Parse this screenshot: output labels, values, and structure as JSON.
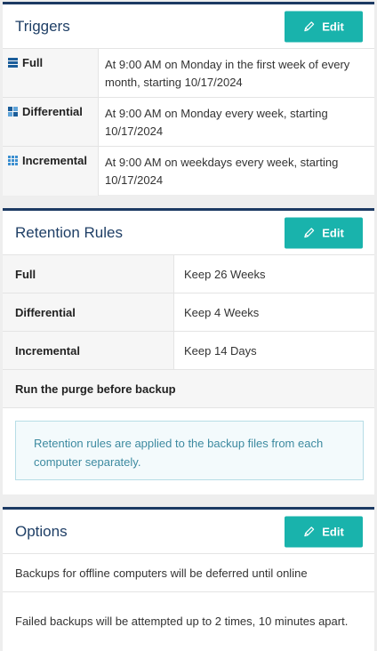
{
  "triggers": {
    "title": "Triggers",
    "edit_label": "Edit",
    "rows": [
      {
        "icon": "full-backup-icon",
        "name": "Full",
        "schedule": "At 9:00 AM on Monday in the first week of every month, starting 10/17/2024"
      },
      {
        "icon": "differential-backup-icon",
        "name": "Differential",
        "schedule": "At 9:00 AM on Monday every week, starting 10/17/2024"
      },
      {
        "icon": "incremental-backup-icon",
        "name": "Incremental",
        "schedule": "At 9:00 AM on weekdays every week, starting 10/17/2024"
      }
    ]
  },
  "retention": {
    "title": "Retention Rules",
    "edit_label": "Edit",
    "rows": [
      {
        "name": "Full",
        "value": "Keep 26 Weeks"
      },
      {
        "name": "Differential",
        "value": "Keep 4 Weeks"
      },
      {
        "name": "Incremental",
        "value": "Keep 14 Days"
      }
    ],
    "purge_label": "Run the purge before backup",
    "info": "Retention rules are applied to the backup files from each computer separately."
  },
  "options": {
    "title": "Options",
    "edit_label": "Edit",
    "rows": [
      "Backups for offline computers will be deferred until online",
      "Failed backups will be attempted up to 2 times, 10 minutes apart."
    ]
  },
  "colors": {
    "accent": "#19b3ac",
    "header_border": "#1c3a63",
    "title": "#1f3f66",
    "icon_blue": "#1a5d9a",
    "info_text": "#3d8aa0"
  }
}
